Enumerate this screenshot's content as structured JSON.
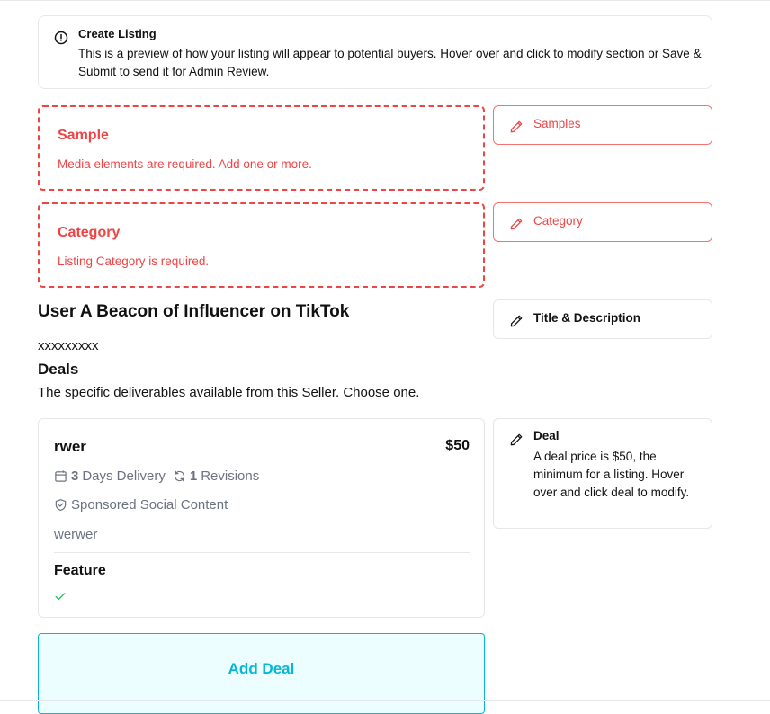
{
  "banner": {
    "icon": "info-circle-icon",
    "title": "Create Listing",
    "text": "This is a preview of how your listing will appear to potential buyers. Hover over and click to modify section or Save & Submit to send it for Admin Review."
  },
  "sections": {
    "sample": {
      "title": "Sample",
      "message": "Media elements are required. Add one or more."
    },
    "category": {
      "title": "Category",
      "message": "Listing Category is required."
    }
  },
  "side_cards": {
    "samples": {
      "label": "Samples",
      "icon": "pencil-icon"
    },
    "category": {
      "label": "Category",
      "icon": "pencil-icon"
    },
    "title_description": {
      "label": "Title & Description",
      "icon": "pencil-icon"
    },
    "deal": {
      "label": "Deal",
      "icon": "pencil-icon",
      "text": "A deal price is $50, the minimum for a listing. Hover over and click deal to modify."
    }
  },
  "listing": {
    "title": "User A Beacon of Influencer on TikTok",
    "description": "xxxxxxxxx"
  },
  "deals": {
    "heading": "Deals",
    "subtitle": "The specific deliverables available from this Seller. Choose one.",
    "items": [
      {
        "name": "rwer",
        "price": "$50",
        "delivery_days": "3",
        "delivery_label": "Days Delivery",
        "revisions": "1",
        "revisions_label": "Revisions",
        "type": "Sponsored Social Content",
        "description": "werwer",
        "feature_label": "Feature"
      }
    ],
    "add_label": "Add Deal"
  },
  "colors": {
    "error": "#ef4444",
    "accent": "#06b6d4",
    "accent_bg": "#ecfeff",
    "muted": "#6b7280",
    "check": "#22c55e"
  }
}
